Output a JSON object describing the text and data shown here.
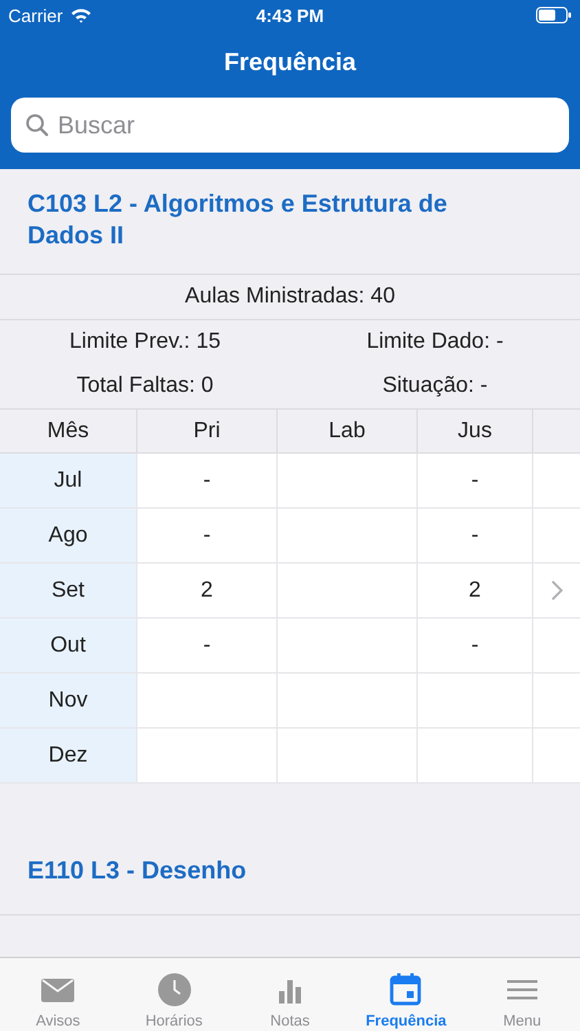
{
  "status_bar": {
    "carrier": "Carrier",
    "time": "4:43 PM"
  },
  "nav": {
    "title": "Frequência"
  },
  "search": {
    "placeholder": "Buscar"
  },
  "courses": [
    {
      "title": "C103 L2 - Algoritmos e Estrutura de Dados II",
      "aulas": "Aulas Ministradas: 40",
      "limite_prev": "Limite Prev.: 15",
      "limite_dado": "Limite Dado: -",
      "total_faltas": "Total Faltas: 0",
      "situacao": "Situação: -",
      "table": {
        "columns": [
          "Mês",
          "Pri",
          "Lab",
          "Jus"
        ],
        "rows": [
          {
            "cells": [
              "Jul",
              "-",
              "",
              "-"
            ],
            "chevron": false
          },
          {
            "cells": [
              "Ago",
              "-",
              "",
              "-"
            ],
            "chevron": false
          },
          {
            "cells": [
              "Set",
              "2",
              "",
              "2"
            ],
            "chevron": true
          },
          {
            "cells": [
              "Out",
              "-",
              "",
              "-"
            ],
            "chevron": false
          },
          {
            "cells": [
              "Nov",
              "",
              "",
              ""
            ],
            "chevron": false
          },
          {
            "cells": [
              "Dez",
              "",
              "",
              ""
            ],
            "chevron": false
          }
        ]
      }
    },
    {
      "title": "E110 L3 - Desenho"
    }
  ],
  "tab_bar": [
    {
      "label": "Avisos",
      "kind": "mail",
      "selected": false
    },
    {
      "label": "Horários",
      "kind": "clock",
      "selected": false
    },
    {
      "label": "Notas",
      "kind": "chart",
      "selected": false
    },
    {
      "label": "Frequência",
      "kind": "calendar",
      "selected": true
    },
    {
      "label": "Menu",
      "kind": "menu",
      "selected": false
    }
  ]
}
